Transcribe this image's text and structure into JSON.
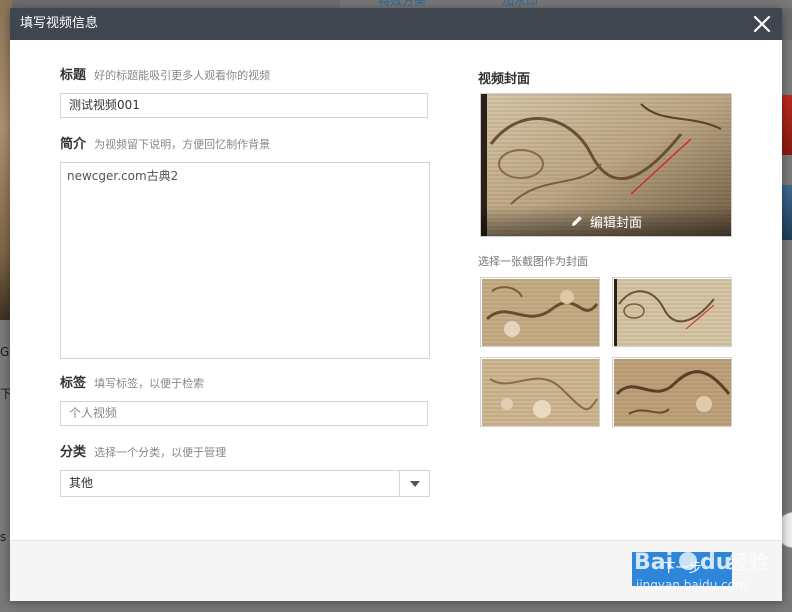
{
  "background": {
    "tabs": [
      "特效方美",
      "加水印"
    ],
    "left_fragments": [
      "G",
      "下",
      "s"
    ]
  },
  "modal": {
    "title": "填写视频信息",
    "title_field": {
      "label": "标题",
      "hint": "好的标题能吸引更多人观看你的视频",
      "value": "测试视频001"
    },
    "description_field": {
      "label": "简介",
      "hint": "为视频留下说明，方便回忆制作背景",
      "value": "newcger.com古典2"
    },
    "tags_field": {
      "label": "标签",
      "hint": "填写标签，以便于检索",
      "placeholder": "个人视频"
    },
    "category_field": {
      "label": "分类",
      "hint": "选择一个分类，以便于管理",
      "selected": "其他"
    },
    "cover": {
      "title": "视频封面",
      "edit_label": "编辑封面",
      "pick_hint": "选择一张截图作为封面"
    },
    "footer": {
      "next_label": "下一步"
    }
  },
  "watermark": {
    "brand": "Bai du 经验",
    "url": "jingyan.baidu.com"
  },
  "icons": {
    "close": "close-icon",
    "edit": "pencil-icon",
    "dropdown": "caret-down-icon"
  },
  "colors": {
    "header_bg": "#3f464f",
    "primary_button": "#2d86d9"
  }
}
